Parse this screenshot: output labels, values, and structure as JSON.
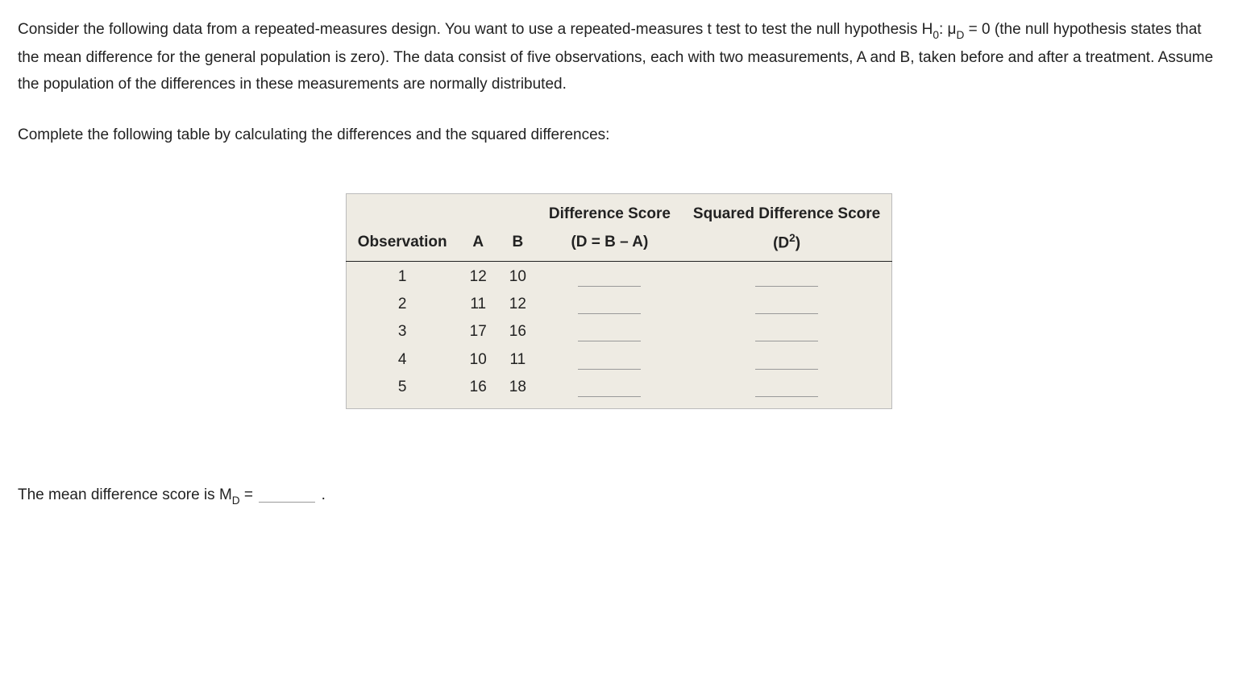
{
  "paragraph1_pre": "Consider the following data from a repeated-measures design. You want to use a repeated-measures t test to test the null hypothesis H",
  "paragraph1_sub1": "0",
  "paragraph1_mid1": ": μ",
  "paragraph1_sub2": "D",
  "paragraph1_post": " = 0 (the null hypothesis states that the mean difference for the general population is zero). The data consist of five observations, each with two measurements, A and B, taken before and after a treatment. Assume the population of the differences in these measurements are normally distributed.",
  "paragraph2": "Complete the following table by calculating the differences and the squared differences:",
  "table": {
    "headers": {
      "obs": "Observation",
      "a": "A",
      "b": "B",
      "diff_top": "Difference Score",
      "diff_bot": "(D = B – A)",
      "sq_top": "Squared Difference Score",
      "sq_bot_pre": "(D",
      "sq_bot_sup": "2",
      "sq_bot_post": ")"
    },
    "rows": [
      {
        "obs": "1",
        "a": "12",
        "b": "10"
      },
      {
        "obs": "2",
        "a": "11",
        "b": "12"
      },
      {
        "obs": "3",
        "a": "17",
        "b": "16"
      },
      {
        "obs": "4",
        "a": "10",
        "b": "11"
      },
      {
        "obs": "5",
        "a": "16",
        "b": "18"
      }
    ]
  },
  "final_pre": "The mean difference score is M",
  "final_sub": "D",
  "final_mid": " = ",
  "final_post": " ."
}
